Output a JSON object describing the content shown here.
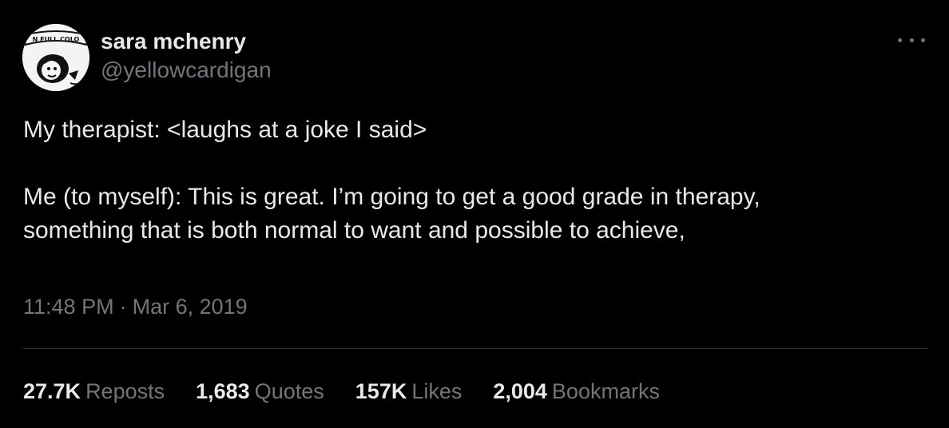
{
  "user": {
    "display_name": "sara mchenry",
    "handle": "@yellowcardigan",
    "avatar_text": "N FULL COLO"
  },
  "tweet": {
    "line1": "My therapist: <laughs at a joke I said>",
    "line2": "Me (to myself): This is great. I’m going to get a good grade in therapy,",
    "line3": "something that is both normal to want and possible to achieve,"
  },
  "meta": {
    "time": "11:48 PM",
    "separator": "·",
    "date": "Mar 6, 2019"
  },
  "stats": [
    {
      "count": "27.7K",
      "label": "Reposts"
    },
    {
      "count": "1,683",
      "label": "Quotes"
    },
    {
      "count": "157K",
      "label": "Likes"
    },
    {
      "count": "2,004",
      "label": "Bookmarks"
    }
  ],
  "icons": {
    "more": "more-horizontal-icon"
  },
  "colors": {
    "background": "#000000",
    "primary_text": "#e7e9ea",
    "secondary_text": "#71767b",
    "divider": "#2f3336"
  }
}
